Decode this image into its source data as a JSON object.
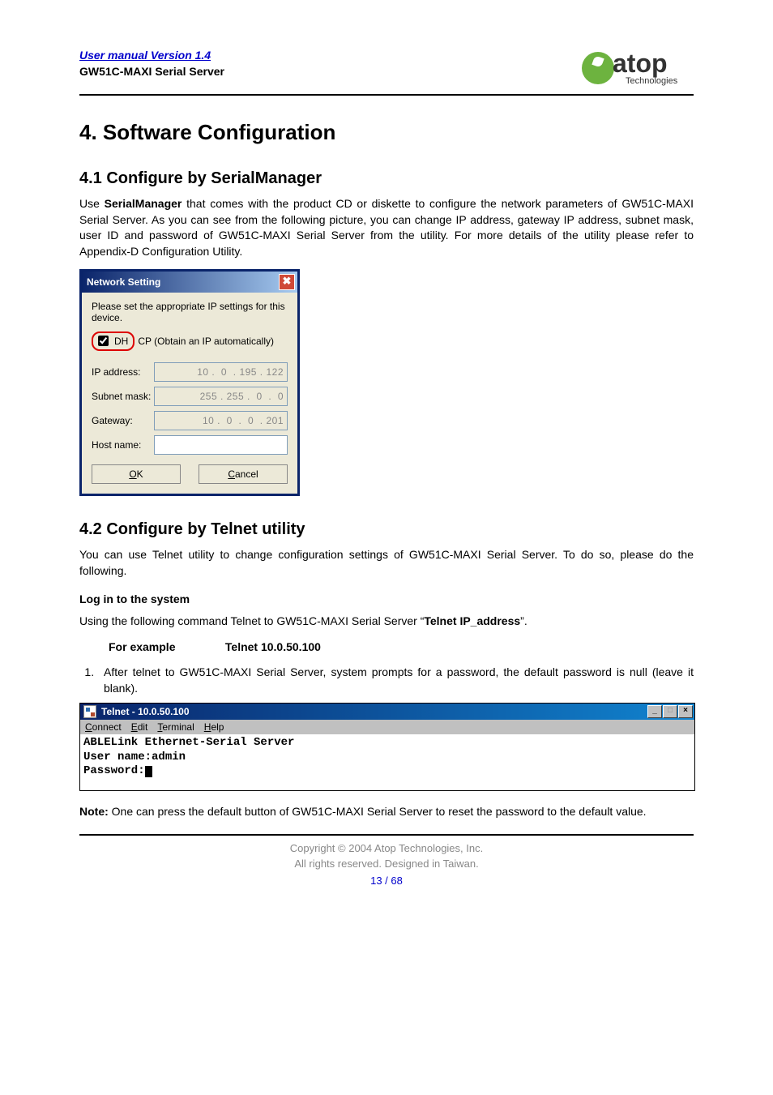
{
  "header": {
    "version_link": "User manual Version 1.4",
    "product": "GW51C-MAXI Serial Server",
    "logo_text": "atop",
    "logo_sub": "Technologies"
  },
  "h1": "4. Software Configuration",
  "section41": {
    "title": "4.1 Configure by SerialManager",
    "para_pre": "Use ",
    "para_bold": "SerialManager",
    "para_post": " that comes with the product CD or diskette to configure the network parameters of GW51C-MAXI Serial Server. As you can see from the following picture, you can change IP address, gateway IP address, subnet mask, user ID and password of GW51C-MAXI Serial Server from the utility. For more details of the utility please refer to Appendix-D Configuration Utility."
  },
  "ns_dialog": {
    "title": "Network Setting",
    "instruction": "Please set the appropriate IP settings for this device.",
    "dhcp_prefix": "DH",
    "dhcp_suffix": "CP (Obtain an IP automatically)",
    "fields": {
      "ip_label": "IP address:",
      "ip_value": "10 .  0  . 195 . 122",
      "subnet_label": "Subnet mask:",
      "subnet_value": "255 . 255 .  0  .  0",
      "gateway_label": "Gateway:",
      "gateway_value": "10 .  0  .  0  . 201",
      "host_label": "Host name:",
      "host_value": ""
    },
    "ok_prefix": "O",
    "ok_suffix": "K",
    "cancel_prefix": "C",
    "cancel_suffix": "ancel"
  },
  "section42": {
    "title": "4.2 Configure by Telnet utility",
    "para": "You can use Telnet utility to change configuration settings of GW51C-MAXI Serial Server. To do so, please do the following.",
    "login_heading": "Log in to the system",
    "login_para_pre": "Using the following command Telnet to GW51C-MAXI Serial Server “",
    "login_para_bold": "Telnet IP_address",
    "login_para_post": "”.",
    "example_label": "For example",
    "example_value": "Telnet 10.0.50.100",
    "step1": "After telnet to GW51C-MAXI Serial Server, system prompts for a password, the default password is null (leave it blank)."
  },
  "telnet": {
    "title": "Telnet - 10.0.50.100",
    "menu": {
      "connect_u": "C",
      "connect_r": "onnect",
      "edit_u": "E",
      "edit_r": "dit",
      "terminal_u": "T",
      "terminal_r": "erminal",
      "help_u": "H",
      "help_r": "elp"
    },
    "line1": "ABLELink Ethernet-Serial Server",
    "line2": "User name:admin",
    "line3": "Password:"
  },
  "note": {
    "label": "Note:",
    "text": " One can press the default button of GW51C-MAXI Serial Server to reset the password to the default value."
  },
  "footer": {
    "copyright": "Copyright © 2004 Atop Technologies, Inc.",
    "rights": "All rights reserved. Designed in Taiwan.",
    "page": "13 / 68"
  }
}
